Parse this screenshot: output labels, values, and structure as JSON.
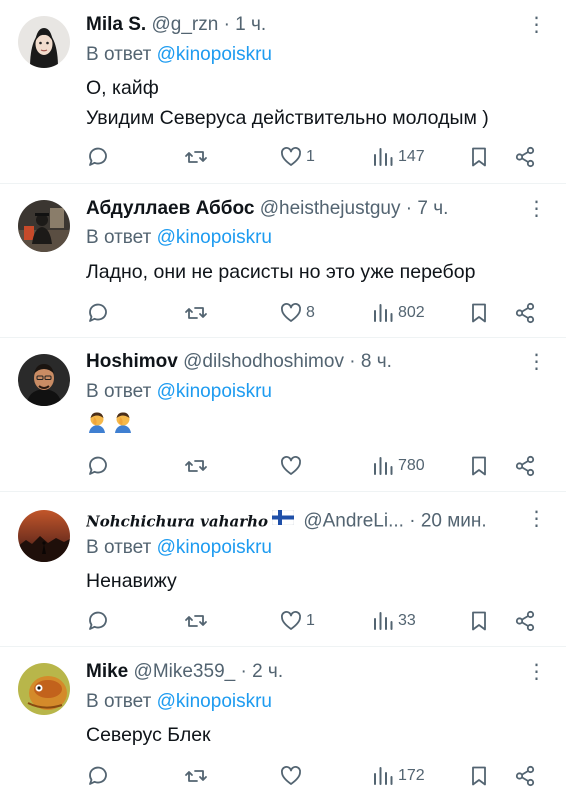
{
  "reply_prefix": "В ответ",
  "tweets": [
    {
      "name": "Mila S.",
      "handle": "@g_rzn",
      "time": "· 1 ч.",
      "mention": "@kinopoiskru",
      "lines": [
        "О, кайф",
        "Увидим Северуса действительно молодым )"
      ],
      "replies": "",
      "retweets": "",
      "likes": "1",
      "views": "147"
    },
    {
      "name": "Абдуллаев Аббос",
      "handle": "@heisthejustguy",
      "time": "· 7 ч.",
      "mention": "@kinopoiskru",
      "lines": [
        "Ладно, они не расисты но это уже перебор"
      ],
      "replies": "",
      "retweets": "",
      "likes": "8",
      "views": "802"
    },
    {
      "name": "Hoshimov",
      "handle": "@dilshodhoshimov",
      "time": "· 8 ч.",
      "mention": "@kinopoiskru",
      "emoji": [
        "facepalm-emoji",
        "facepalm-emoji"
      ],
      "replies": "",
      "retweets": "",
      "likes": "",
      "views": "780"
    },
    {
      "name": "𝑵𝒐𝒉𝒄𝒉𝒊𝒄𝒉𝒖𝒓𝒂 𝒗𝒂𝒉𝒂𝒓𝒉𝒐",
      "flag": "finland-flag-emoji",
      "handle": "@AndreLi...",
      "time": "· 20 мин.",
      "mention": "@kinopoiskru",
      "lines": [
        "Ненавижу"
      ],
      "replies": "",
      "retweets": "",
      "likes": "1",
      "views": "33"
    },
    {
      "name": "Mike",
      "handle": "@Mike359_",
      "time": "· 2 ч.",
      "mention": "@kinopoiskru",
      "lines": [
        "Северус Блек"
      ],
      "replies": "",
      "retweets": "",
      "likes": "",
      "views": "172"
    }
  ],
  "colors": {
    "text": "#0f1419",
    "secondary": "#536471",
    "link": "#1d9bf0",
    "divider": "#eff3f4"
  },
  "icons": {
    "more": "more-dots-icon",
    "reply": "reply-bubble-icon",
    "retweet": "retweet-icon",
    "like": "heart-icon",
    "views": "views-bar-icon",
    "bookmark": "bookmark-icon",
    "share": "share-icon"
  }
}
